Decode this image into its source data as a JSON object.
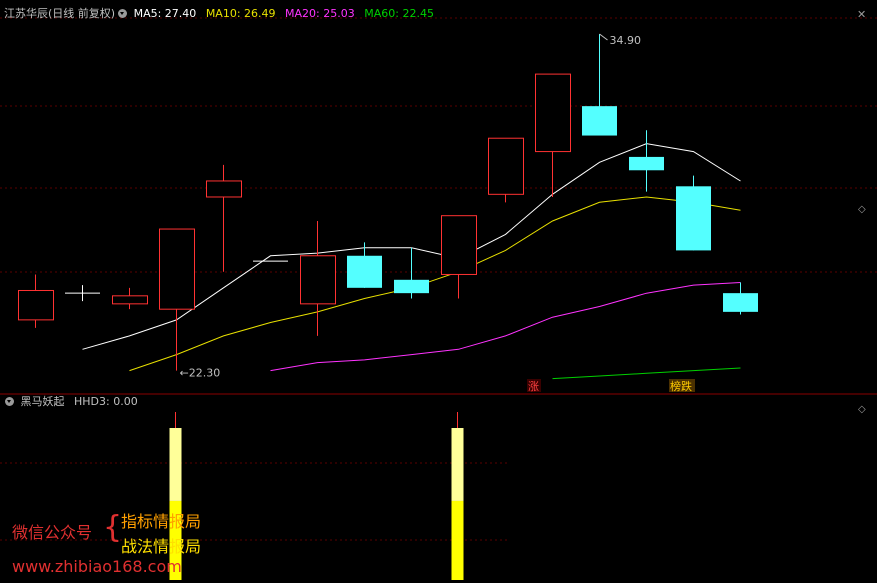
{
  "main_header": {
    "title": "江苏华辰(日线 前复权)",
    "ma5": "MA5: 27.40",
    "ma10": "MA10: 26.49",
    "ma20": "MA20: 25.03",
    "ma60": "MA60: 22.45",
    "colors": {
      "title": "#c0c0c0",
      "ma5": "#ffffff",
      "ma10": "#e8e000",
      "ma20": "#ff33ff",
      "ma60": "#00d000"
    }
  },
  "indicator_header": {
    "name": "黑马妖起",
    "value": "HHD3: 0.00"
  },
  "watermark": {
    "wechat": "微信公众号",
    "line1": "指标情报局",
    "line2": "战法情报局",
    "url": "www.zhibiao168.com"
  },
  "colors": {
    "up": "#ff3232",
    "down": "#54ffff",
    "grid": "#5a0000",
    "bar": "#ffff00",
    "bar_light": "#ffff99"
  },
  "chart_data": {
    "type": "candlestick",
    "price_range": [
      21.5,
      35.5
    ],
    "annotations": {
      "high": "34.90",
      "low": "22.30"
    },
    "tags": [
      "涨",
      "榜跌"
    ],
    "candles": [
      {
        "open": 24.2,
        "close": 25.3,
        "high": 25.9,
        "low": 23.9
      },
      {
        "open": 25.2,
        "close": 25.2,
        "high": 25.5,
        "low": 24.9
      },
      {
        "open": 24.8,
        "close": 25.1,
        "high": 25.4,
        "low": 24.6
      },
      {
        "open": 24.6,
        "close": 27.6,
        "high": 27.6,
        "low": 22.3
      },
      {
        "open": 28.8,
        "close": 29.4,
        "high": 30.0,
        "low": 26.0
      },
      {
        "open": 26.4,
        "close": 26.4,
        "high": 26.4,
        "low": 26.4
      },
      {
        "open": 24.8,
        "close": 26.6,
        "high": 27.9,
        "low": 23.6
      },
      {
        "open": 26.6,
        "close": 25.4,
        "high": 27.1,
        "low": 25.4
      },
      {
        "open": 25.7,
        "close": 25.2,
        "high": 26.9,
        "low": 25.0
      },
      {
        "open": 25.9,
        "close": 28.1,
        "high": 28.1,
        "low": 25.0
      },
      {
        "open": 28.9,
        "close": 31.0,
        "high": 31.0,
        "low": 28.6
      },
      {
        "open": 30.5,
        "close": 33.4,
        "high": 33.4,
        "low": 28.8
      },
      {
        "open": 32.2,
        "close": 31.1,
        "high": 34.9,
        "low": 31.1
      },
      {
        "open": 30.3,
        "close": 29.8,
        "high": 31.3,
        "low": 29.0
      },
      {
        "open": 29.2,
        "close": 26.8,
        "high": 29.6,
        "low": 26.8
      },
      {
        "open": 25.2,
        "close": 24.5,
        "high": 25.6,
        "low": 24.4
      }
    ],
    "ma": [
      {
        "name": "MA5",
        "values": [
          null,
          23.1,
          23.6,
          24.2,
          25.4,
          26.6,
          26.7,
          26.9,
          26.9,
          26.5,
          27.4,
          28.9,
          30.1,
          30.8,
          30.5,
          29.4
        ]
      },
      {
        "name": "MA10",
        "values": [
          null,
          null,
          22.3,
          22.9,
          23.6,
          24.1,
          24.5,
          25.0,
          25.4,
          26.0,
          26.8,
          27.9,
          28.6,
          28.8,
          28.6,
          28.3
        ]
      },
      {
        "name": "MA20",
        "values": [
          null,
          null,
          null,
          null,
          null,
          22.3,
          22.6,
          22.7,
          22.9,
          23.1,
          23.6,
          24.3,
          24.7,
          25.2,
          25.5,
          25.6
        ]
      },
      {
        "name": "MA60",
        "values": [
          null,
          null,
          null,
          null,
          null,
          null,
          null,
          null,
          null,
          null,
          null,
          22.0,
          22.1,
          22.2,
          22.3,
          22.4
        ]
      }
    ],
    "hhd3": [
      0,
      0,
      0,
      1,
      0,
      0,
      0,
      0,
      0,
      1,
      0,
      0,
      0,
      0,
      0,
      0
    ]
  }
}
